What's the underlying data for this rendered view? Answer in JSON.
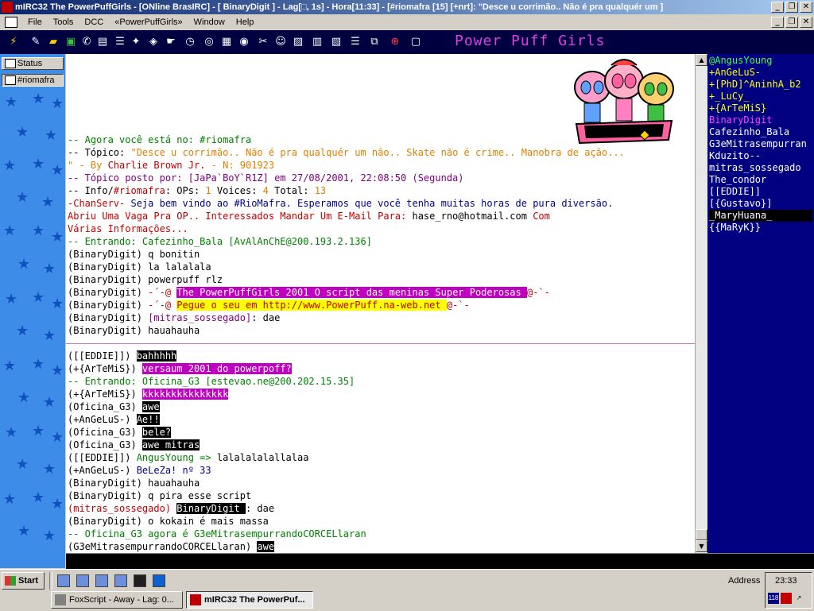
{
  "window": {
    "title": "mIRC32 The PowerPuffGirls - [ONline BrasIRC] - [ BinaryDigit ] - Lag[□, 1s] - Hora[11:33] - [#riomafra [15] [+nrt]: \"Desce u corrimão.. Não é pra qualquér um ]"
  },
  "menu": [
    "File",
    "Tools",
    "DCC",
    "«PowerPuffGirls»",
    "Window",
    "Help"
  ],
  "toolbar": {
    "banner": "Power Puff Girls",
    "icons": [
      "lightning-icon",
      "options-icon",
      "folder-icon",
      "channel-icon",
      "notify-icon",
      "dcc-send-icon",
      "dcc-chat-icon",
      "finger-icon",
      "clock-icon",
      "ignore-icon",
      "url-icon",
      "tile-icon",
      "cascade-icon",
      "lifebuoy-icon"
    ]
  },
  "windows": [
    {
      "label": "Status"
    },
    {
      "label": "#riomafra"
    }
  ],
  "chat": {
    "lines_top": [
      {
        "segments": [
          {
            "t": "-- Agora você está no: #riomafra",
            "c": "g"
          }
        ]
      },
      {
        "segments": [
          {
            "t": "-- Tópico: ",
            "c": "k"
          },
          {
            "t": "\"Desce u corrimão.. Não é pra qualquér um não.. Skate não é crime.. Manobra de ação...",
            "c": "o"
          }
        ]
      },
      {
        "segments": [
          {
            "t": "\" - By ",
            "c": "o"
          },
          {
            "t": "Charlie Brown Jr.",
            "c": "r"
          },
          {
            "t": " - N: 901923",
            "c": "o"
          }
        ]
      },
      {
        "segments": [
          {
            "t": "-- Tópico posto por: [JaPa`BoY`R1Z] em 27/08/2001, 22:08:50 (Segunda)",
            "c": "m"
          }
        ]
      },
      {
        "segments": [
          {
            "t": "-- Info/",
            "c": "k"
          },
          {
            "t": "#riomafra",
            "c": "r"
          },
          {
            "t": ": OPs: ",
            "c": "k"
          },
          {
            "t": "1",
            "c": "o"
          },
          {
            "t": " Voices: ",
            "c": "k"
          },
          {
            "t": "4",
            "c": "o"
          },
          {
            "t": " Total: ",
            "c": "k"
          },
          {
            "t": "13",
            "c": "o"
          }
        ]
      },
      {
        "segments": [
          {
            "t": "-ChanServ-",
            "c": "r"
          },
          {
            "t": " Seja bem vindo ao #RioMafra. Esperamos que você tenha muitas horas de pura diversão.",
            "c": "b"
          }
        ]
      },
      {
        "segments": [
          {
            "t": "Abriu Uma Vaga Pra OP.. Interessados Mandar Um E-Mail Para: ",
            "c": "r"
          },
          {
            "t": "hase_rno@hotmail.com",
            "c": "k"
          },
          {
            "t": " Com",
            "c": "r"
          }
        ]
      },
      {
        "segments": [
          {
            "t": "Várias Informações...",
            "c": "r"
          }
        ]
      },
      {
        "segments": [
          {
            "t": "-- Entrando: Cafezinho_Bala [AvAlAnChE@200.193.2.136]",
            "c": "g"
          }
        ]
      },
      {
        "segments": [
          {
            "t": "(BinaryDigit) q bonitin",
            "c": "k"
          }
        ]
      },
      {
        "segments": [
          {
            "t": "(BinaryDigit) la lalalala",
            "c": "k"
          }
        ]
      },
      {
        "segments": [
          {
            "t": "(BinaryDigit) powerpuff rlz",
            "c": "k"
          }
        ]
      },
      {
        "segments": [
          {
            "t": "(BinaryDigit) ",
            "c": "k"
          },
          {
            "t": "-´-@ ",
            "c": "r"
          },
          {
            "t": " The PowerPuffGirls 2001 ",
            "c": "mg"
          },
          {
            "t": " ",
            "c": "k"
          },
          {
            "t": " O script das meninas Super Poderosas ",
            "c": "mg"
          },
          {
            "t": " @-`-",
            "c": "r"
          }
        ]
      },
      {
        "segments": [
          {
            "t": "(BinaryDigit) ",
            "c": "k"
          },
          {
            "t": "-´-@ ",
            "c": "r"
          },
          {
            "t": " Pegue o seu em http://www.PowerPuff.na-web.net ",
            "c": "yel"
          },
          {
            "t": " @-`-",
            "c": "r"
          }
        ]
      },
      {
        "segments": [
          {
            "t": "(BinaryDigit) ",
            "c": "k"
          },
          {
            "t": "[mitras_sossegado]",
            "c": "m"
          },
          {
            "t": ": dae",
            "c": "k"
          }
        ]
      },
      {
        "segments": [
          {
            "t": "(BinaryDigit) hauahauha",
            "c": "k"
          }
        ]
      }
    ],
    "lines_bottom": [
      {
        "segments": [
          {
            "t": "([[EDDIE]]) ",
            "c": "k"
          },
          {
            "t": "bahhhhh",
            "c": "bk"
          }
        ]
      },
      {
        "segments": [
          {
            "t": "(+{ArTeMiS}) ",
            "c": "k"
          },
          {
            "t": "versaum 2001 do powerpoff?",
            "c": "mg"
          }
        ]
      },
      {
        "segments": [
          {
            "t": "-- Entrando: Oficina_G3 [estevao.ne@200.202.15.35]",
            "c": "g"
          }
        ]
      },
      {
        "segments": [
          {
            "t": "(+{ArTeMiS}) ",
            "c": "k"
          },
          {
            "t": "kkkkkkkkkkkkkkk",
            "c": "mg"
          }
        ]
      },
      {
        "segments": [
          {
            "t": "(Oficina_G3) ",
            "c": "k"
          },
          {
            "t": "awe",
            "c": "bk"
          }
        ]
      },
      {
        "segments": [
          {
            "t": "(+AnGeLuS-) ",
            "c": "k"
          },
          {
            "t": "Ae!!",
            "c": "bk"
          }
        ]
      },
      {
        "segments": [
          {
            "t": "(Oficina_G3) ",
            "c": "k"
          },
          {
            "t": "bele?",
            "c": "bk"
          }
        ]
      },
      {
        "segments": [
          {
            "t": "(Oficina_G3) ",
            "c": "k"
          },
          {
            "t": "awe mitras",
            "c": "bk"
          }
        ]
      },
      {
        "segments": [
          {
            "t": "([[EDDIE]])  ",
            "c": "k"
          },
          {
            "t": "AngusYoung =>",
            "c": "g"
          },
          {
            "t": "  lalalalalallalaa",
            "c": "k"
          }
        ]
      },
      {
        "segments": [
          {
            "t": "(+AnGeLuS-) ",
            "c": "k"
          },
          {
            "t": "BeLeZa! nº 33",
            "c": "b"
          }
        ]
      },
      {
        "segments": [
          {
            "t": "(BinaryDigit) hauahauha",
            "c": "k"
          }
        ]
      },
      {
        "segments": [
          {
            "t": "(BinaryDigit) q pira esse script",
            "c": "k"
          }
        ]
      },
      {
        "segments": [
          {
            "t": "(mitras_sossegado) ",
            "c": "r"
          },
          {
            "t": " BinaryDigit ",
            "c": "bk"
          },
          {
            "t": ": dae",
            "c": "k"
          }
        ]
      },
      {
        "segments": [
          {
            "t": "(BinaryDigit) o kokain é mais massa",
            "c": "k"
          }
        ]
      },
      {
        "segments": [
          {
            "t": "-- Oficina_G3 agora é G3eMitrasempurrandoCORCELlaran",
            "c": "g"
          }
        ]
      },
      {
        "segments": [
          {
            "t": "(G3eMitrasempurrandoCORCELlaran) ",
            "c": "k"
          },
          {
            "t": "awe",
            "c": "bk"
          }
        ]
      }
    ]
  },
  "nicks": [
    {
      "n": "@AngusYoung",
      "c": "#40ff40"
    },
    {
      "n": "+AnGeLuS-",
      "c": "#ffff00"
    },
    {
      "n": "+[PhD]^AninhA_b2",
      "c": "#ffff00"
    },
    {
      "n": "+_LuCy_",
      "c": "#ffff00"
    },
    {
      "n": "+{ArTeMiS}",
      "c": "#ffff00"
    },
    {
      "n": "BinaryDigit",
      "c": "#ff40ff"
    },
    {
      "n": "Cafezinho_Bala",
      "c": "#ffffff"
    },
    {
      "n": "G3eMitrasempurran",
      "c": "#ffffff"
    },
    {
      "n": "Kduzito--",
      "c": "#ffffff"
    },
    {
      "n": "mitras_sossegado",
      "c": "#ffffff"
    },
    {
      "n": "The_condor",
      "c": "#ffffff"
    },
    {
      "n": "[[EDDIE]]",
      "c": "#ffffff"
    },
    {
      "n": "[{Gustavo}]",
      "c": "#ffffff"
    },
    {
      "n": "_MaryHuana_",
      "c": "#ffffff",
      "selected": true
    },
    {
      "n": "{{MaRyK}}",
      "c": "#ffffff"
    }
  ],
  "taskbar": {
    "start": "Start",
    "tasks": [
      {
        "label": "FoxScript - Away - Lag: 0...",
        "active": false
      },
      {
        "label": "mIRC32 The PowerPuf...",
        "active": true
      }
    ],
    "address": "Address",
    "clock": "23:33",
    "tray_badge": "118"
  }
}
